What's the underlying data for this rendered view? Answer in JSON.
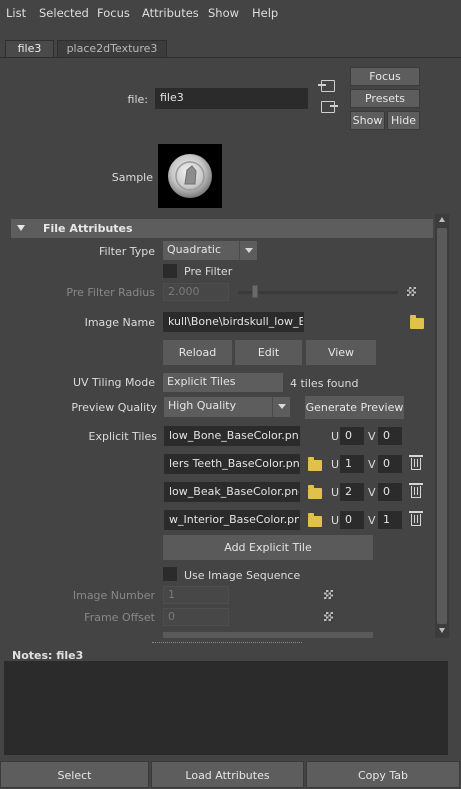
{
  "menu": [
    "List",
    "Selected",
    "Focus",
    "Attributes",
    "Show",
    "Help"
  ],
  "tabs": [
    {
      "label": "file3",
      "active": true
    },
    {
      "label": "place2dTexture3",
      "active": false
    }
  ],
  "node": {
    "label": "file:",
    "value": "file3",
    "focus_label": "Focus",
    "presets_label": "Presets",
    "show_label": "Show",
    "hide_label": "Hide",
    "sample_label": "Sample"
  },
  "section": {
    "title": "File Attributes"
  },
  "filter": {
    "type_label": "Filter Type",
    "type_value": "Quadratic",
    "prefilter_label": "Pre Filter",
    "prefilter_checked": false,
    "prefilter_radius_label": "Pre Filter Radius",
    "prefilter_radius_value": "2.000"
  },
  "image": {
    "label": "Image Name",
    "value": "kull\\Bone\\birdskull_low_Bone_BaseColor.png",
    "reload_label": "Reload",
    "edit_label": "Edit",
    "view_label": "View"
  },
  "uv_tiling": {
    "mode_label": "UV Tiling Mode",
    "mode_value": "Explicit Tiles",
    "tiles_found": "4 tiles found",
    "preview_quality_label": "Preview Quality",
    "preview_quality_value": "High Quality",
    "generate_preview_label": "Generate Preview",
    "explicit_tiles_label": "Explicit Tiles",
    "add_tile_label": "Add Explicit Tile",
    "tiles": [
      {
        "file": "low_Bone_BaseColor.png",
        "u": "0",
        "v": "0",
        "deletable": false
      },
      {
        "file": "lers Teeth_BaseColor.png",
        "u": "1",
        "v": "0",
        "deletable": true
      },
      {
        "file": "low_Beak_BaseColor.png",
        "u": "2",
        "v": "0",
        "deletable": true
      },
      {
        "file": "w_Interior_BaseColor.png",
        "u": "0",
        "v": "1",
        "deletable": true
      }
    ],
    "u_label": "U",
    "v_label": "V"
  },
  "sequence": {
    "use_label": "Use Image Sequence",
    "use_checked": false,
    "image_number_label": "Image Number",
    "image_number_value": "1",
    "frame_offset_label": "Frame Offset",
    "frame_offset_value": "0"
  },
  "notes": {
    "label": "Notes:  file3",
    "value": ""
  },
  "bottom": {
    "select_label": "Select",
    "load_label": "Load Attributes",
    "copy_label": "Copy Tab"
  },
  "colors": {
    "background": "#444444",
    "field": "#2b2b2b",
    "button": "#5d5d5d",
    "folder": "#e2c14a"
  },
  "icons": [
    "input-connection-icon",
    "output-connection-icon",
    "folder-icon",
    "trash-icon",
    "checker-icon",
    "collapse-triangle-icon"
  ]
}
